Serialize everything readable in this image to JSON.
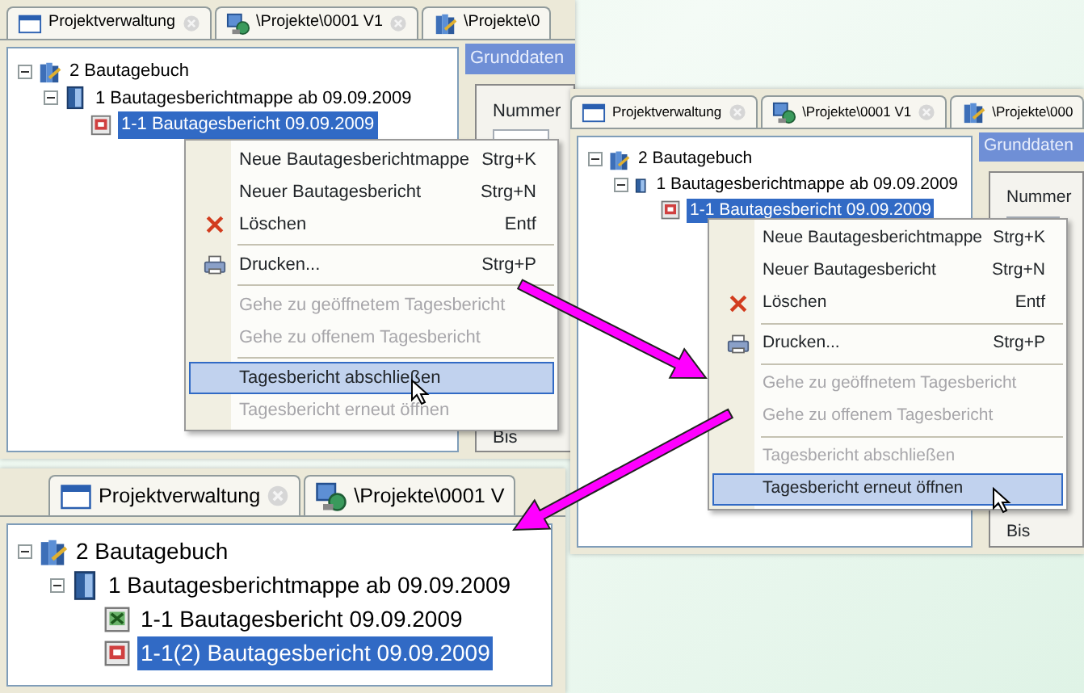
{
  "screenshots": [
    {
      "tabs": [
        {
          "label": "Projektverwaltung",
          "kind": "window",
          "closable": true
        },
        {
          "label": "\\Projekte\\0001 V1",
          "kind": "network",
          "closable": true
        },
        {
          "label": "\\Projekte\\0",
          "kind": "book",
          "closable": false
        }
      ],
      "tree": [
        {
          "label": "2 Bautagebuch",
          "kind": "book",
          "selected": false,
          "expanded": true,
          "children": [
            {
              "label": "1 Bautagesberichtmappe ab 09.09.2009",
              "kind": "folder",
              "selected": false,
              "expanded": true,
              "children": [
                {
                  "label": "1-1 Bautagesbericht 09.09.2009",
                  "kind": "report-open",
                  "selected": true
                }
              ]
            }
          ]
        }
      ],
      "detail_panel": {
        "header": "Grunddaten",
        "labels": [
          "Nummer",
          "Bis"
        ]
      },
      "context_menu": [
        {
          "label": "Neue Bautagesberichtmappe",
          "shortcut": "Strg+K",
          "kind": "plain",
          "separator_before": false,
          "disabled": false,
          "highlighted": false
        },
        {
          "label": "Neuer Bautagesbericht",
          "shortcut": "Strg+N",
          "kind": "plain",
          "separator_before": false,
          "disabled": false,
          "highlighted": false
        },
        {
          "label": "Löschen",
          "shortcut": "Entf",
          "kind": "delete",
          "separator_before": false,
          "disabled": false,
          "highlighted": false
        },
        {
          "label": "Drucken...",
          "shortcut": "Strg+P",
          "kind": "print",
          "separator_before": true,
          "disabled": false,
          "highlighted": false
        },
        {
          "label": "Gehe zu geöffnetem Tagesbericht",
          "kind": "plain",
          "separator_before": true,
          "disabled": true,
          "highlighted": false
        },
        {
          "label": "Gehe zu offenem Tagesbericht",
          "kind": "plain",
          "separator_before": false,
          "disabled": true,
          "highlighted": false
        },
        {
          "label": "Tagesbericht abschließen",
          "kind": "plain",
          "separator_before": true,
          "disabled": false,
          "highlighted": true
        },
        {
          "label": "Tagesbericht erneut öffnen",
          "kind": "plain",
          "separator_before": false,
          "disabled": true,
          "highlighted": false
        }
      ]
    },
    {
      "tabs": [
        {
          "label": "Projektverwaltung",
          "kind": "window",
          "closable": true
        },
        {
          "label": "\\Projekte\\0001 V1",
          "kind": "network",
          "closable": true
        },
        {
          "label": "\\Projekte\\000",
          "kind": "book",
          "closable": false
        }
      ],
      "tree": [
        {
          "label": "2 Bautagebuch",
          "kind": "book",
          "selected": false,
          "expanded": true,
          "children": [
            {
              "label": "1 Bautagesberichtmappe ab 09.09.2009",
              "kind": "folder",
              "selected": false,
              "expanded": true,
              "children": [
                {
                  "label": "1-1 Bautagesbericht 09.09.2009",
                  "kind": "report-open",
                  "selected": true
                }
              ]
            }
          ]
        }
      ],
      "detail_panel": {
        "header": "Grunddaten",
        "labels": [
          "Nummer",
          "Bis"
        ]
      },
      "context_menu": [
        {
          "label": "Neue Bautagesberichtmappe",
          "shortcut": "Strg+K",
          "kind": "plain",
          "separator_before": false,
          "disabled": false,
          "highlighted": false
        },
        {
          "label": "Neuer Bautagesbericht",
          "shortcut": "Strg+N",
          "kind": "plain",
          "separator_before": false,
          "disabled": false,
          "highlighted": false
        },
        {
          "label": "Löschen",
          "shortcut": "Entf",
          "kind": "delete",
          "separator_before": false,
          "disabled": false,
          "highlighted": false
        },
        {
          "label": "Drucken...",
          "shortcut": "Strg+P",
          "kind": "print",
          "separator_before": true,
          "disabled": false,
          "highlighted": false
        },
        {
          "label": "Gehe zu geöffnetem Tagesbericht",
          "kind": "plain",
          "separator_before": true,
          "disabled": true,
          "highlighted": false
        },
        {
          "label": "Gehe zu offenem Tagesbericht",
          "kind": "plain",
          "separator_before": false,
          "disabled": true,
          "highlighted": false
        },
        {
          "label": "Tagesbericht abschließen",
          "kind": "plain",
          "separator_before": true,
          "disabled": true,
          "highlighted": false
        },
        {
          "label": "Tagesbericht erneut öffnen",
          "kind": "plain",
          "separator_before": false,
          "disabled": false,
          "highlighted": true
        }
      ]
    },
    {
      "tabs": [
        {
          "label": "Projektverwaltung",
          "kind": "window",
          "closable": true
        },
        {
          "label": "\\Projekte\\0001 V",
          "kind": "network",
          "closable": false
        }
      ],
      "tree": [
        {
          "label": "2 Bautagebuch",
          "kind": "book",
          "selected": false,
          "expanded": true,
          "children": [
            {
              "label": "1 Bautagesberichtmappe ab 09.09.2009",
              "kind": "folder",
              "selected": false,
              "expanded": true,
              "children": [
                {
                  "label": "1-1 Bautagesbericht 09.09.2009",
                  "kind": "report-closed",
                  "selected": false
                },
                {
                  "label": "1-1(2) Bautagesbericht 09.09.2009",
                  "kind": "report-open",
                  "selected": true
                }
              ]
            }
          ]
        }
      ]
    }
  ]
}
